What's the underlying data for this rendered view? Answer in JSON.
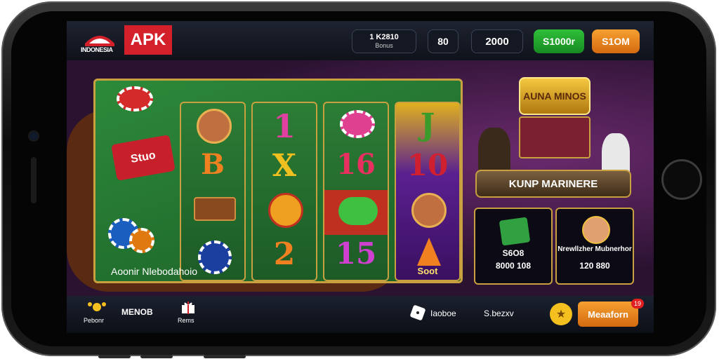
{
  "header": {
    "logo_text": "INDONESIA",
    "apk_label": "APK",
    "balance": {
      "value": "1 K2810",
      "sub": "Bonus"
    },
    "pill_1": "80",
    "pill_2": "2000",
    "green_button": "S1000r",
    "orange_button": "S1OM"
  },
  "reels": {
    "reel_1": [
      "1",
      "B",
      "X"
    ],
    "reel_2": [
      "1",
      "X",
      "2"
    ],
    "reel_3": [
      "16",
      "15"
    ],
    "reel_4": [
      "J",
      "10"
    ],
    "reel_4_label": "Soot",
    "felt_label": "Aoonir Nlebodahoio",
    "chip_label": "Stuo"
  },
  "scene": {
    "sign_text": "AUNA MINOS",
    "banner_text": "KUNP MARINERE",
    "card_1": {
      "line_1": "S6O8",
      "line_2": "8000 108"
    },
    "card_2": {
      "line_1": "Nrewllzher Mubnerhor",
      "line_2": "120 880"
    }
  },
  "footer": {
    "item_1_label": "Pebonr",
    "item_1_title": "MENOB",
    "item_2_label": "Rems",
    "item_3_label": "Iaoboe",
    "item_4_label": "S.bezxv",
    "claim_label": "Meaaforn",
    "claim_badge": "19"
  },
  "colors": {
    "apk_red": "#d4202a",
    "felt_green": "#2d8a3a",
    "gold": "#c9a040",
    "orange": "#f5a030",
    "green_btn": "#2fbf3a"
  }
}
